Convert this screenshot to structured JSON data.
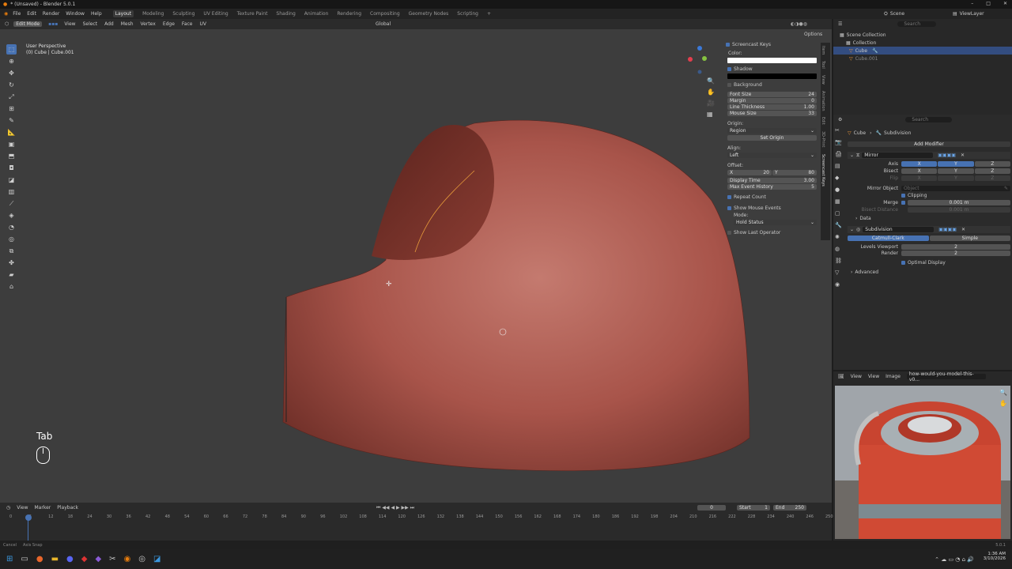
{
  "window": {
    "title": "* (Unsaved) - Blender 5.0.1",
    "controls": [
      "–",
      "□",
      "✕"
    ]
  },
  "menu": [
    "File",
    "Edit",
    "Render",
    "Window",
    "Help"
  ],
  "workspaces": [
    "Layout",
    "Modeling",
    "Sculpting",
    "UV Editing",
    "Texture Paint",
    "Shading",
    "Animation",
    "Rendering",
    "Compositing",
    "Geometry Nodes",
    "Scripting",
    "+"
  ],
  "scene": {
    "label": "Scene",
    "view_layer": "ViewLayer"
  },
  "viewport_header": {
    "mode": "Edit Mode",
    "menus": [
      "View",
      "Select",
      "Add",
      "Mesh",
      "Vertex",
      "Edge",
      "Face",
      "UV"
    ],
    "transform": "Global",
    "options": "Options"
  },
  "viewport_info": {
    "view": "User Perspective",
    "object": "(0) Cube | Cube.001"
  },
  "screencast_panel": {
    "title": "Screencast Keys",
    "color_label": "Color:",
    "shadow": "Shadow",
    "background": "Background",
    "font_size": {
      "label": "Font Size",
      "value": "24"
    },
    "margin": {
      "label": "Margin",
      "value": "0"
    },
    "line_thickness": {
      "label": "Line Thickness",
      "value": "1.00"
    },
    "mouse_size": {
      "label": "Mouse Size",
      "value": "33"
    },
    "origin_label": "Origin:",
    "origin_value": "Region",
    "set_origin": "Set Origin",
    "align_label": "Align:",
    "align_value": "Left",
    "offset_label": "Offset:",
    "offset_x": "20",
    "offset_y": "80",
    "display_time": {
      "label": "Display Time",
      "value": "3.00"
    },
    "max_event_history": {
      "label": "Max Event History",
      "value": "5"
    },
    "repeat_count": "Repeat Count",
    "show_mouse_events": "Show Mouse Events",
    "mode_label": "Mode:",
    "mode_value": "Hold Status",
    "show_last_operator": "Show Last Operator",
    "side_tabs": [
      "Item",
      "Tool",
      "View",
      "Animation",
      "Edit",
      "3D-Print",
      "Screencast Keys"
    ]
  },
  "screencast_overlay": {
    "key": "Tab"
  },
  "outliner": {
    "search_placeholder": "Search",
    "items": [
      {
        "label": "Scene Collection"
      },
      {
        "label": "Collection"
      },
      {
        "label": "Cube"
      },
      {
        "label": "Cube.001"
      }
    ]
  },
  "properties": {
    "search_placeholder": "Search",
    "breadcrumb_object": "Cube",
    "breadcrumb_modifier": "Subdivision",
    "add_modifier": "Add Modifier",
    "mirror": {
      "name": "Mirror",
      "axis_label": "Axis",
      "bisect_label": "Bisect",
      "flip_label": "Flip",
      "axes": [
        "X",
        "Y",
        "Z"
      ],
      "mirror_object_label": "Mirror Object",
      "mirror_object_placeholder": "Object",
      "clipping": "Clipping",
      "merge_label": "Merge",
      "merge_value": "0.001 m",
      "bisect_distance_label": "Bisect Distance",
      "bisect_distance_value": "0.001 m",
      "data_label": "Data"
    },
    "subdivision": {
      "name": "Subdivision",
      "tab_active": "Catmull-Clark",
      "tab_inactive": "Simple",
      "levels_viewport_label": "Levels Viewport",
      "levels_viewport_value": "2",
      "render_label": "Render",
      "render_value": "2",
      "optimal_display": "Optimal Display",
      "advanced": "Advanced"
    }
  },
  "image_editor": {
    "menus": [
      "View",
      "View",
      "Image"
    ],
    "image_name": "how-would-you-model-this-v0..."
  },
  "timeline": {
    "menus": [
      "View",
      "Marker",
      "Playback"
    ],
    "current_frame": "0",
    "start_label": "Start",
    "start_value": "1",
    "end_label": "End",
    "end_value": "250",
    "ticks": [
      "0",
      "6",
      "12",
      "18",
      "24",
      "30",
      "36",
      "42",
      "48",
      "54",
      "60",
      "66",
      "72",
      "78",
      "84",
      "90",
      "96",
      "102",
      "108",
      "114",
      "120",
      "126",
      "132",
      "138",
      "144",
      "150",
      "156",
      "162",
      "168",
      "174",
      "180",
      "186",
      "192",
      "198",
      "204",
      "210",
      "216",
      "222",
      "228",
      "234",
      "240",
      "246",
      "250"
    ]
  },
  "statusbar": {
    "left": "Cancel",
    "left2": "Axis Snap",
    "version": "5.0.1"
  },
  "taskbar": {
    "time": "1:36 AM",
    "date": "3/10/2026"
  },
  "colors": {
    "accent": "#4772b3",
    "mesh": "#b55a4e",
    "viewport_bg": "#3d3d3d",
    "panel_bg": "#2b2b2b"
  }
}
